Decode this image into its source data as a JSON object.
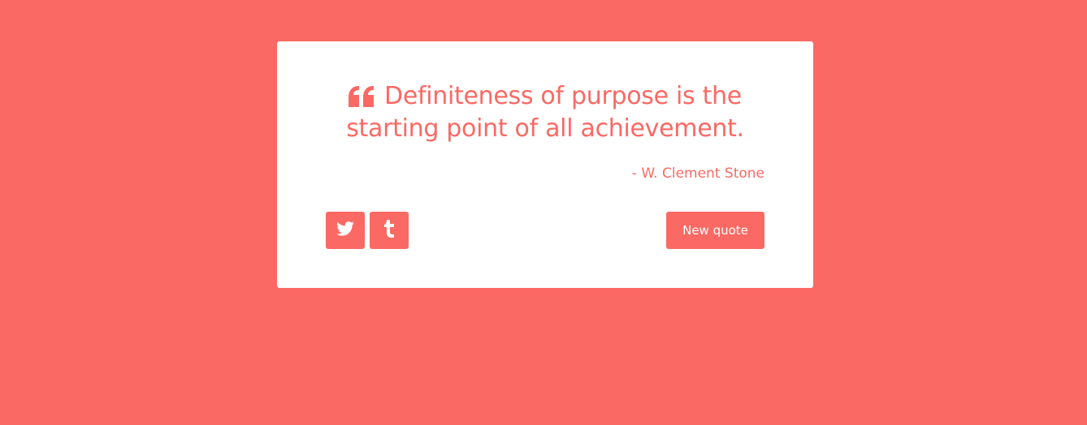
{
  "quote": {
    "text": "Definiteness of purpose is the starting point of all achievement.",
    "author": "- W. Clement Stone",
    "icon": "quote-left-icon"
  },
  "actions": {
    "twitter_icon": "twitter-icon",
    "tumblr_icon": "tumblr-icon",
    "new_quote_label": "New quote"
  },
  "colors": {
    "background": "#fb6964",
    "card": "#ffffff",
    "accent": "#fb6964"
  }
}
